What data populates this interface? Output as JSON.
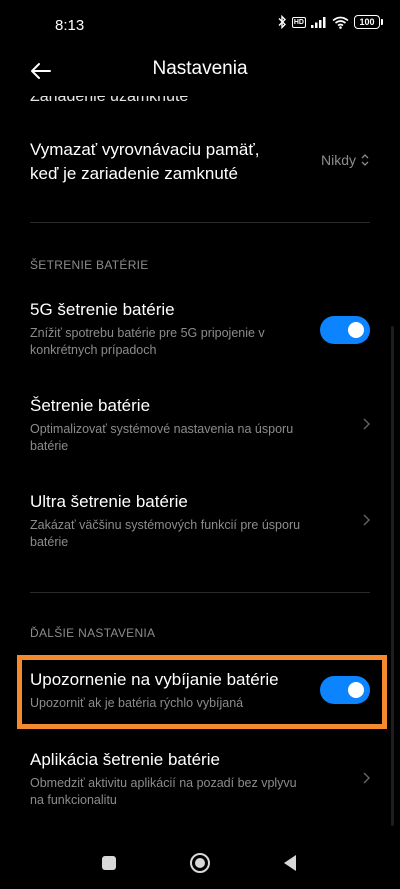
{
  "status": {
    "time": "8:13",
    "battery": "100"
  },
  "header": {
    "title": "Nastavenia"
  },
  "cut_item": {
    "title": "Zariadenie uzamknuté"
  },
  "clear_cache": {
    "title_line1": "Vymazať vyrovnávaciu pamäť,",
    "title_line2": "keď je zariadenie zamknuté",
    "value": "Nikdy"
  },
  "battery_section": {
    "header": "ŠETRENIE BATÉRIE",
    "items": [
      {
        "title": "5G šetrenie batérie",
        "sub_line1": "Znížiť spotrebu batérie pre 5G pripojenie v",
        "sub_line2": "konkrétnych prípadoch",
        "toggle": true
      },
      {
        "title": "Šetrenie batérie",
        "sub_line1": "Optimalizovať systémové nastavenia na úsporu",
        "sub_line2": "batérie"
      },
      {
        "title": "Ultra šetrenie batérie",
        "sub_line1": "Zakázať väčšinu systémových funkcií pre úsporu",
        "sub_line2": "batérie"
      }
    ]
  },
  "more_section": {
    "header": "ĎALŠIE NASTAVENIA",
    "items": [
      {
        "title": "Upozornenie na vybíjanie batérie",
        "sub_line1": "Upozorniť ak je batéria rýchlo vybíjaná",
        "toggle": true
      },
      {
        "title": "Aplikácia šetrenie batérie",
        "sub_line1": "Obmedziť aktivitu aplikácií na pozadí bez vplyvu",
        "sub_line2": "na funkcionalitu"
      }
    ]
  },
  "colors": {
    "accent": "#0d84ff",
    "highlight": "#f5892e",
    "secondary_text": "#8c8c8c"
  }
}
